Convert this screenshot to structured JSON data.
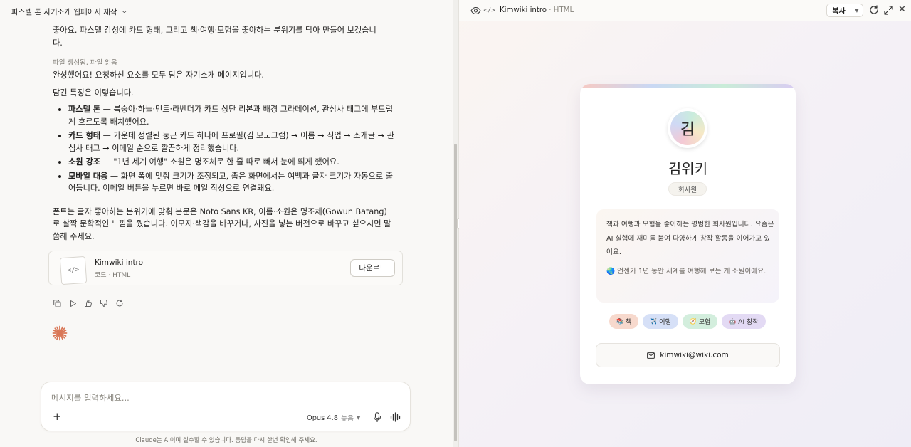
{
  "conversation": {
    "title": "파스텔 톤 자기소개 웹페이지 제작",
    "messages": {
      "intro_tail_1": "좋아요. 파스텔 감성에 카드 형태, 그리고 책·여행·모험을 좋아하는 분위기를 담아 만들어 보겠습니",
      "intro_tail_2": "다.",
      "tool_status": "파일 생성됨, 파일 읽음",
      "done": "완성했어요! 요청하신 요소를 모두 담은 자기소개 페이지입니다.",
      "features_title": "담긴 특징은 이렇습니다.",
      "features": [
        {
          "bold": "파스텔 톤",
          "text": " — 복숭아·하늘·민트·라벤더가 카드 상단 리본과 배경 그라데이션, 관심사 태그에 부드럽게 흐르도록 배치했어요."
        },
        {
          "bold": "카드 형태",
          "text": " — 가운데 정렬된 둥근 카드 하나에 프로필(김 모노그램) → 이름 → 직업 → 소개글 → 관심사 태그 → 이메일 순으로 깔끔하게 정리했습니다."
        },
        {
          "bold": "소원 강조",
          "text": " — \"1년 세계 여행\" 소원은 명조체로 한 줄 따로 빼서 눈에 띄게 했어요."
        },
        {
          "bold": "모바일 대응",
          "text": " — 화면 폭에 맞춰 크기가 조정되고, 좁은 화면에서는 여백과 글자 크기가 자동으로 줄어듭니다. 이메일 버튼을 누르면 바로 메일 작성으로 연결돼요."
        }
      ],
      "closing": "폰트는 글자 좋아하는 분위기에 맞춰 본문은 Noto Sans KR, 이름·소원은 명조체(Gowun Batang)로 살짝 문학적인 느낌을 줬습니다. 이모지·색감을 바꾸거나, 사진을 넣는 버전으로 바꾸고 싶으시면 말씀해 주세요."
    },
    "artifact": {
      "name": "Kimwiki intro",
      "meta": "코드 · HTML",
      "download_label": "다운로드",
      "thumb_glyph": "</>"
    },
    "composer": {
      "placeholder": "메시지를 입력하세요...",
      "plus": "+",
      "model": "Opus 4.8",
      "effort": "높음"
    },
    "disclaimer": "Claude는 AI이며 실수할 수 있습니다. 응답을 다시 한번 확인해 주세요."
  },
  "preview": {
    "title": "Kimwiki intro",
    "separator": " · ",
    "type": "HTML",
    "copy_label": "복사",
    "code_glyph": "</>",
    "close_glyph": "✕",
    "card": {
      "monogram": "김",
      "name": "김위키",
      "role": "회사원",
      "bio": "책과 여행과 모험을 좋아하는 평범한 회사원입니다. 요즘은 AI 실험에 재미를 붙여 다양하게 창작 활동을 이어가고 있어요.",
      "wish": "🌏 언젠가 1년 동안 세계를 여행해 보는 게 소원이에요.",
      "tags": [
        {
          "icon": "📚",
          "label": "책",
          "color": "#f7d9cd"
        },
        {
          "icon": "✈️",
          "label": "여행",
          "color": "#d6e0f7"
        },
        {
          "icon": "🧭",
          "label": "모험",
          "color": "#d3eedd"
        },
        {
          "icon": "🤖",
          "label": "AI 창작",
          "color": "#e3daf4"
        }
      ],
      "email": "kimwiki@wiki.com"
    }
  },
  "colors": {
    "brand_spark": "#d97757",
    "accent_peach": "#f7c9c2",
    "accent_sky": "#c9d8f4",
    "accent_mint": "#c9ecd8",
    "accent_lavender": "#d9ccf2"
  }
}
